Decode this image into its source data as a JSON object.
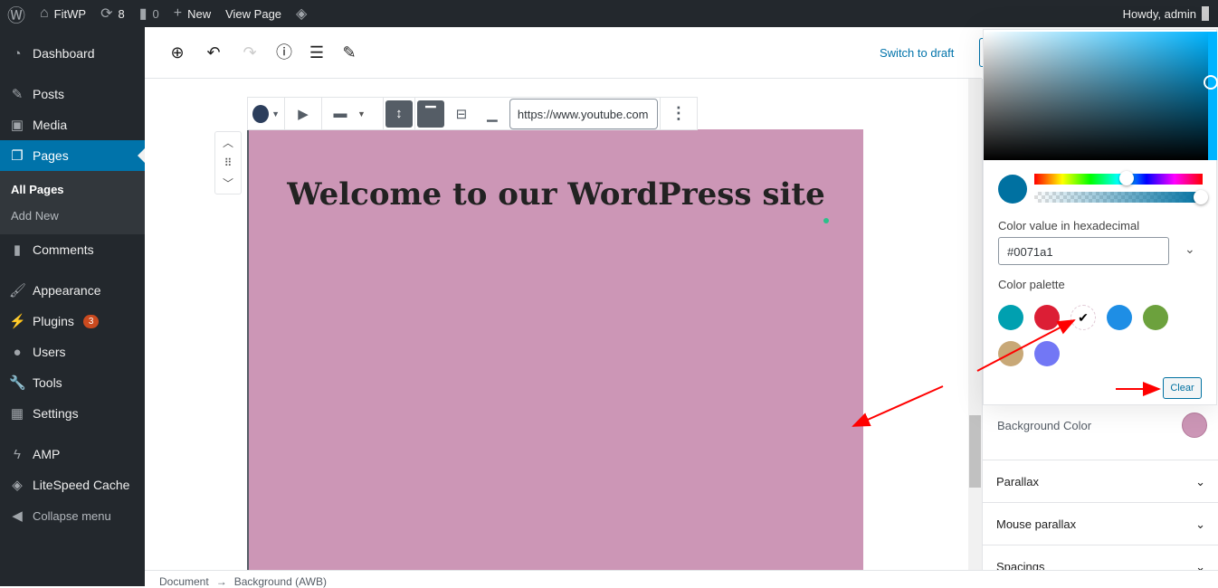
{
  "adminbar": {
    "site": "FitWP",
    "updates": "8",
    "comments": "0",
    "new": "New",
    "view": "View Page",
    "howdy": "Howdy, admin"
  },
  "sidebar": {
    "items": [
      {
        "label": "Dashboard",
        "icon": "dashboard-icon"
      },
      {
        "label": "Posts",
        "icon": "pin-icon"
      },
      {
        "label": "Media",
        "icon": "media-icon"
      },
      {
        "label": "Pages",
        "icon": "pages-icon"
      },
      {
        "label": "Comments",
        "icon": "comment-icon"
      },
      {
        "label": "Appearance",
        "icon": "brush-icon"
      },
      {
        "label": "Plugins",
        "icon": "plugin-icon",
        "badge": "3"
      },
      {
        "label": "Users",
        "icon": "user-icon"
      },
      {
        "label": "Tools",
        "icon": "wrench-icon"
      },
      {
        "label": "Settings",
        "icon": "settings-icon"
      },
      {
        "label": "AMP",
        "icon": "amp-icon"
      },
      {
        "label": "LiteSpeed Cache",
        "icon": "litespeed-icon"
      },
      {
        "label": "Collapse menu",
        "icon": "collapse-icon"
      }
    ],
    "sub": {
      "all": "All Pages",
      "add": "Add New"
    }
  },
  "header": {
    "switch_draft": "Switch to draft"
  },
  "toolbar": {
    "url": "https://www.youtube.com"
  },
  "content": {
    "heading": "Welcome to our WordPress site"
  },
  "footer": {
    "crumb1": "Document",
    "sep": "→",
    "crumb2": "Background (AWB)"
  },
  "picker": {
    "hex_label": "Color value in hexadecimal",
    "hex": "#0071a1",
    "palette_label": "Color palette",
    "clear": "Clear",
    "palette": [
      "#00a0b0",
      "#dc1e35",
      "#ffffff",
      "#1e8ee5",
      "#6ca13d",
      "#c8a877",
      "#7277f5"
    ],
    "current": "#0071a1"
  },
  "settings": {
    "bg_color_label": "Background Color",
    "bg_color": "#cc96b6",
    "panels": [
      "Parallax",
      "Mouse parallax",
      "Spacings"
    ]
  }
}
